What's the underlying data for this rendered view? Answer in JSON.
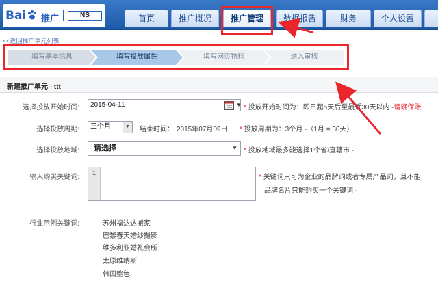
{
  "logo": {
    "brand_text": "Bai",
    "product": "推广",
    "account": "NS"
  },
  "nav": {
    "tabs": [
      {
        "label": "首页"
      },
      {
        "label": "推广概况"
      },
      {
        "label": "推广管理",
        "active": true
      },
      {
        "label": "数据报告"
      },
      {
        "label": "财务"
      },
      {
        "label": "个人设置"
      },
      {
        "label": ""
      }
    ]
  },
  "back_link": "<<返回推广单元列表",
  "steps": [
    {
      "label": "填写基本信息",
      "state": "done"
    },
    {
      "label": "填写投放属性",
      "state": "current"
    },
    {
      "label": "填写网页物料",
      "state": "todo"
    },
    {
      "label": "进入审核",
      "state": "todo"
    }
  ],
  "form": {
    "title": "新建推广单元 - ttt",
    "start_date": {
      "label": "选择投放开始时间:",
      "value": "2015-04-11",
      "hint_prefix": "投放开始时间为：即日起5天后至最近30天以内 -",
      "hint_red": "请确保账"
    },
    "period": {
      "label": "选择投放周期:",
      "value": "三个月",
      "end_label": "结束时间：",
      "end_value": "2015年07月09日",
      "hint": "投放周期为：3个月 -（1月 = 30天）"
    },
    "region": {
      "label": "选择投放地域:",
      "value": "请选择",
      "hint": "投放地域最多能选择1个省/直辖市 -"
    },
    "keywords": {
      "label": "输入购买关键词:",
      "gutter_num": "1",
      "hint_line1": "关键词只可为企业的品牌词或者专属产品词，且不能",
      "hint_line2": "品牌名片只能购买一个关键词 -"
    },
    "examples": {
      "label": "行业示例关键词:",
      "items": [
        "苏州福达达搬家",
        "巴黎春天婚纱摄影",
        "维多利亚婚礼会所",
        "太原维纳斯",
        "韩国整色"
      ]
    }
  },
  "colors": {
    "annotation_red": "#e8262c",
    "nav_blue": "#2a62c0"
  }
}
